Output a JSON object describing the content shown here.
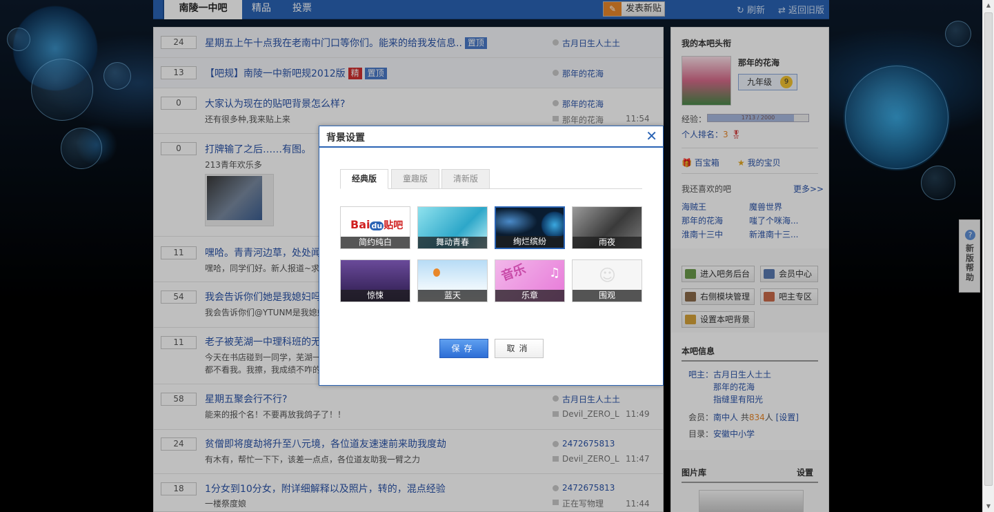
{
  "nav": {
    "forum_name": "南陵一中吧",
    "tabs": [
      "精品",
      "投票"
    ],
    "post_button": "发表新贴",
    "refresh": "刷新",
    "old_version": "返回旧版"
  },
  "threads": [
    {
      "count": "24",
      "title": "星期五上午十点我在老南中门口等你们。能来的给我发信息..",
      "tags": [
        "置顶"
      ],
      "author": "古月日生人土土",
      "desc": "",
      "last_user": "",
      "time": ""
    },
    {
      "count": "13",
      "title": "【吧规】南陵一中新吧规2012版",
      "tags": [
        "精",
        "置顶"
      ],
      "author": "那年的花海",
      "desc": "",
      "last_user": "",
      "time": ""
    },
    {
      "count": "0",
      "title": "大家认为现在的贴吧背景怎么样?",
      "tags": [],
      "author": "那年的花海",
      "desc": "还有很多种,我来贴上来",
      "last_user": "那年的花海",
      "time": "11:54"
    },
    {
      "count": "0",
      "title": "打牌输了之后……有图。",
      "tags": [],
      "author": "",
      "desc": "213青年欢乐多",
      "last_user": "",
      "time": ""
    },
    {
      "count": "11",
      "title": "嘿哈。青青河边草，处处闻",
      "tags": [],
      "author": "",
      "desc": "嘿哈，同学们好。新人报道~求",
      "last_user": "",
      "time": ""
    },
    {
      "count": "54",
      "title": "我会告诉你们她是我媳妇吗",
      "tags": [],
      "author": "",
      "desc": "我会告诉你们@YTUNM是我媳妇",
      "last_user": "",
      "time": ""
    },
    {
      "count": "11",
      "title": "老子被芜湖一中理科班的无",
      "tags": [],
      "author": "",
      "desc": "今天在书店碰到一同学，芜湖一",
      "desc2": "都不看我。我擦，我成绩不咋的",
      "last_user": "",
      "time": ""
    },
    {
      "count": "58",
      "title": "星期五聚会行不行?",
      "tags": [],
      "author": "古月日生人土土",
      "desc": "能来的报个名！不要再放我鸽子了！！",
      "last_user": "Devil_ZERO_L",
      "time": "11:49"
    },
    {
      "count": "24",
      "title": "贫僧即将度劫将升至八元境，各位道友速速前来助我度劫",
      "tags": [],
      "author": "2472675813",
      "desc": "有木有，帮忙一下下，该差一点点，各位道友助我一臂之力",
      "last_user": "Devil_ZERO_L",
      "time": "11:47"
    },
    {
      "count": "18",
      "title": "1分女到10分女，附详细解释以及照片，转的，混点经验",
      "tags": [],
      "author": "2472675813",
      "desc": "一楼祭度娘",
      "last_user": "正在写物理",
      "time": "11:44"
    }
  ],
  "sidebar": {
    "my_title": "我的本吧头衔",
    "username": "那年的花海",
    "level_name": "九年级",
    "level_num": "9",
    "exp_label": "经验：",
    "exp_text": "1713 / 2000",
    "exp_fraction": 0.8565,
    "rank_label": "个人排名：",
    "rank_value": "3",
    "treasure": "百宝箱",
    "my_baby": "我的宝贝",
    "also_like": "我还喜欢的吧",
    "more": "更多>>",
    "liked": [
      "海贼王",
      "魔兽世界",
      "那年的花海",
      "嗤了个咪海...",
      "淮南十三中",
      "新淮南十三..."
    ],
    "buttons": [
      "进入吧务后台",
      "会员中心",
      "右侧模块管理",
      "吧主专区",
      "设置本吧背景"
    ],
    "info_title": "本吧信息",
    "owner_label": "吧主：",
    "owners": [
      "古月日生人土土",
      "那年的花海",
      "指缝里有阳光"
    ],
    "member_label": "会员：",
    "member_name": "南中人",
    "member_pre": "共",
    "member_count": "834",
    "member_unit": "人",
    "member_set": "[设置]",
    "dir_label": "目录：",
    "dir_value": "安徽中小学",
    "gallery": "图片库",
    "gallery_set": "设置"
  },
  "help": {
    "label": "新版帮助",
    "icon": "?"
  },
  "dialog": {
    "title": "背景设置",
    "tabs": [
      "经典版",
      "童趣版",
      "清新版"
    ],
    "themes": [
      {
        "name": "简约纯白",
        "logo1": "Bai",
        "logo2": "du",
        "logo3": "贴吧"
      },
      {
        "name": "舞动青春"
      },
      {
        "name": "绚烂缤纷"
      },
      {
        "name": "雨夜"
      },
      {
        "name": "惊悚"
      },
      {
        "name": "蓝天"
      },
      {
        "name": "乐章",
        "art": "音乐"
      },
      {
        "name": "围观"
      }
    ],
    "save": "保存",
    "cancel": "取消"
  },
  "colors": {
    "nav": "#2a63b4",
    "link": "#2a53a8",
    "accent": "#e8872a"
  }
}
